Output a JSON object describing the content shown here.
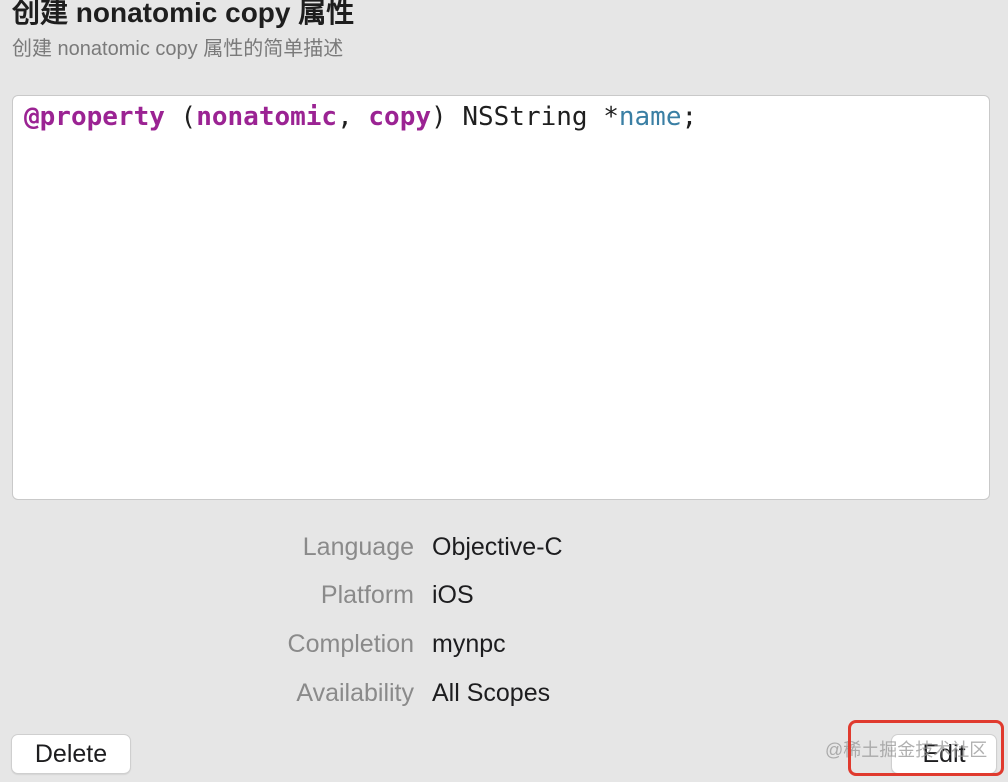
{
  "header": {
    "title": "创建 nonatomic copy 属性",
    "subtitle": "创建 nonatomic copy 属性的简单描述"
  },
  "editor": {
    "code_tokens": {
      "at_property": "@property",
      "space1": " ",
      "open_paren": "(",
      "nonatomic": "nonatomic",
      "comma": ", ",
      "copy": "copy",
      "close_paren_type": ") NSString *",
      "name": "name",
      "semicolon": ";"
    }
  },
  "meta": {
    "language": {
      "label": "Language",
      "value": "Objective-C"
    },
    "platform": {
      "label": "Platform",
      "value": "iOS"
    },
    "completion": {
      "label": "Completion",
      "value": "mynpc"
    },
    "availability": {
      "label": "Availability",
      "value": "All Scopes"
    }
  },
  "buttons": {
    "delete": "Delete",
    "edit": "Edit"
  },
  "watermark": "@稀土掘金技术社区",
  "colors": {
    "keyword": "#9b2393",
    "identifier": "#3a7fa4",
    "highlight_box": "#e03a2e"
  }
}
